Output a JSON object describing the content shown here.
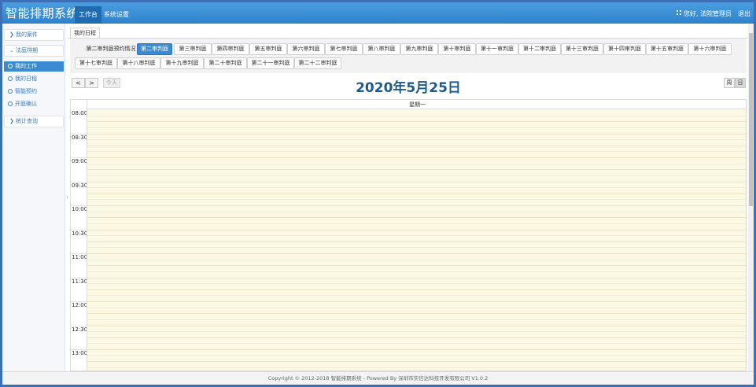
{
  "header": {
    "brand": "智能排期系统",
    "tabs": [
      {
        "label": "工作台"
      },
      {
        "label": "系统设置"
      }
    ],
    "greeting": "您好, 法院管理员",
    "logout": "退出"
  },
  "sidebar": {
    "groups": [
      {
        "label": "我的案件"
      },
      {
        "label": "法庭排期"
      },
      {
        "label": "统计查询"
      }
    ],
    "items": [
      {
        "label": "我的工作"
      },
      {
        "label": "我的日程"
      },
      {
        "label": "智能预约"
      },
      {
        "label": "开庭确认"
      }
    ]
  },
  "page_tab": "我的日程",
  "courts": {
    "row1": [
      "第二审判庭预约情况",
      "第二审判庭",
      "第三审判庭",
      "第四审判庭",
      "第五审判庭",
      "第六审判庭",
      "第七审判庭",
      "第八审判庭",
      "第九审判庭",
      "第十审判庭",
      "第十一审判庭",
      "第十二审判庭",
      "第十三审判庭",
      "第十四审判庭",
      "第十五审判庭",
      "第十六审判庭"
    ],
    "row2": [
      "第十七审判庭",
      "第十八审判庭",
      "第十九审判庭",
      "第二十审判庭",
      "第二十一审判庭",
      "第二十二审判庭"
    ]
  },
  "calendar": {
    "prev": "<",
    "next": ">",
    "today": "今天",
    "title": "2020年5月25日",
    "view_week": "周",
    "view_day": "日",
    "day_header": "星期一",
    "times": [
      "08:00",
      "08:30",
      "09:00",
      "09:30",
      "10:00",
      "10:30",
      "11:00",
      "11:30",
      "12:00",
      "12:30",
      "13:00"
    ]
  },
  "footer": "Copyright © 2012-2018 智能排期系统 - Powered By 深圳市实信达科技开发有限公司 V1.0.2",
  "colors": {
    "header": "#2d82cc",
    "active": "#3a8bd2",
    "slot": "#fbf8e3",
    "title": "#1e5a8c"
  }
}
